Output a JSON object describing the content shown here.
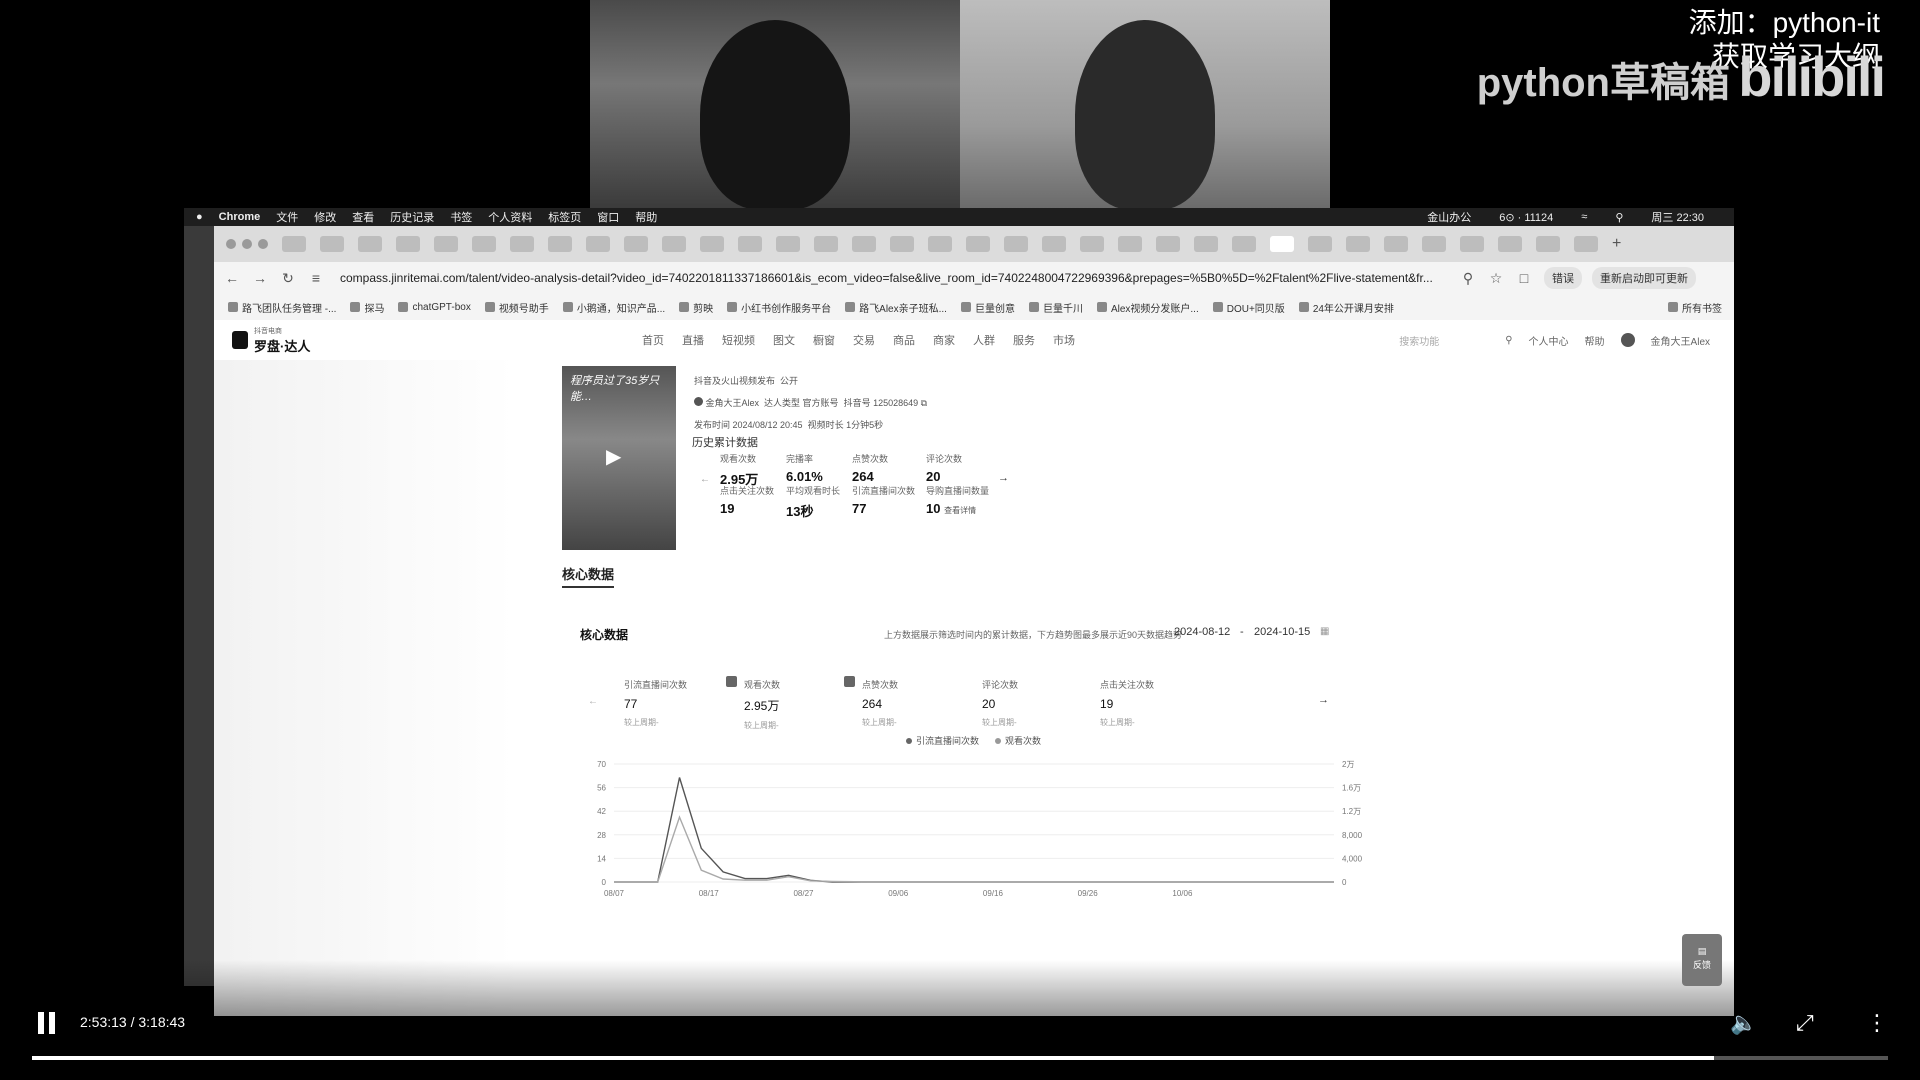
{
  "overlay": {
    "line1": "添加：python-it",
    "line2": "获取学习大纲",
    "brand": "python草稿箱",
    "platform": "bilibili"
  },
  "menubar": {
    "app": "Chrome",
    "items": [
      "文件",
      "修改",
      "查看",
      "历史记录",
      "书签",
      "个人资料",
      "标签页",
      "窗口",
      "帮助"
    ],
    "status_item": "金山办公",
    "counter": "6⊙ · 11124",
    "clock": "周三 22:30"
  },
  "browser": {
    "url": "compass.jinritemai.com/talent/video-analysis-detail?video_id=7402201811337186601&is_ecom_video=false&live_room_id=7402248004722969396&prepages=%5B0%5D=%2Ftalent%2Flive-statement&fr...",
    "pill_error": "错误",
    "pill_update": "重新启动即可更新",
    "bookmarks": [
      "路飞团队任务管理 -...",
      "探马",
      "chatGPT-box",
      "视频号助手",
      "小鹅通，知识产品...",
      "剪映",
      "小红书创作服务平台",
      "路飞Alex亲子班私...",
      "巨量创意",
      "巨量千川",
      "Alex视频分发账户...",
      "DOU+同贝版",
      "24年公开课月安排"
    ],
    "bookmarks_more": "所有书签"
  },
  "site": {
    "logo_small": "抖音电商",
    "logo": "罗盘·达人",
    "nav": [
      "首页",
      "直播",
      "短视频",
      "图文",
      "橱窗",
      "交易",
      "商品",
      "商家",
      "人群",
      "服务",
      "市场"
    ],
    "search_placeholder": "搜索功能",
    "user_center": "个人中心",
    "help": "帮助",
    "username": "金角大王Alex"
  },
  "video": {
    "thumb_caption": "程序员过了35岁只能…",
    "source": "抖音及火山视频发布",
    "visibility": "公开",
    "author": "金角大王Alex",
    "author_type": "达人类型 官方账号",
    "douyin_id": "抖音号 125028649",
    "publish_time": "发布时间 2024/08/12 20:45",
    "duration": "视频时长 1分钟5秒",
    "history_title": "历史累计数据",
    "metrics": [
      {
        "label": "观看次数",
        "value": "2.95万"
      },
      {
        "label": "完播率",
        "value": "6.01%"
      },
      {
        "label": "点赞次数",
        "value": "264"
      },
      {
        "label": "评论次数",
        "value": "20"
      },
      {
        "label": "点击关注次数",
        "value": "19"
      },
      {
        "label": "平均观看时长",
        "value": "13秒"
      },
      {
        "label": "引流直播间次数",
        "value": "77"
      },
      {
        "label": "导购直播间数量",
        "value": "10"
      }
    ],
    "view_detail": "查看详情"
  },
  "core": {
    "tab": "核心数据",
    "card_title": "核心数据",
    "note": "上方数据展示筛选时间内的累计数据，下方趋势图最多展示近90天数据趋势",
    "date_start": "2024-08-12",
    "date_sep": "-",
    "date_end": "2024-10-15",
    "kpis": [
      {
        "label": "引流直播间次数",
        "value": "77",
        "sub": "较上周期-",
        "checked": true
      },
      {
        "label": "观看次数",
        "value": "2.95万",
        "sub": "较上周期-",
        "checked": true
      },
      {
        "label": "点赞次数",
        "value": "264",
        "sub": "较上周期-",
        "checked": false
      },
      {
        "label": "评论次数",
        "value": "20",
        "sub": "较上周期-",
        "checked": false
      },
      {
        "label": "点击关注次数",
        "value": "19",
        "sub": "较上周期-",
        "checked": false
      }
    ],
    "legend": [
      "引流直播间次数",
      "观看次数"
    ]
  },
  "chart_data": {
    "type": "line",
    "x": [
      "08/07",
      "08/17",
      "08/27",
      "09/06",
      "09/16",
      "09/26",
      "10/06"
    ],
    "left_ticks": [
      "70",
      "56",
      "42",
      "28",
      "14",
      "0"
    ],
    "right_ticks": [
      "2万",
      "1.6万",
      "1.2万",
      "8,000",
      "4,000",
      "0"
    ],
    "ylim_left": [
      0,
      70
    ],
    "ylim_right": [
      0,
      20000
    ],
    "series": [
      {
        "name": "引流直播间次数",
        "axis": "left",
        "values": [
          0,
          0,
          0,
          62,
          20,
          6,
          2,
          2,
          4,
          1,
          0,
          0,
          0,
          0,
          0,
          0,
          0,
          0,
          0,
          0
        ]
      },
      {
        "name": "观看次数",
        "axis": "right",
        "values": [
          0,
          0,
          0,
          11000,
          2000,
          500,
          300,
          300,
          900,
          200,
          100,
          50,
          0,
          0,
          0,
          0,
          0,
          0,
          0,
          0
        ]
      }
    ]
  },
  "player": {
    "time": "2:53:13 / 3:18:43",
    "progress": 0.906,
    "feedback": "反馈"
  }
}
